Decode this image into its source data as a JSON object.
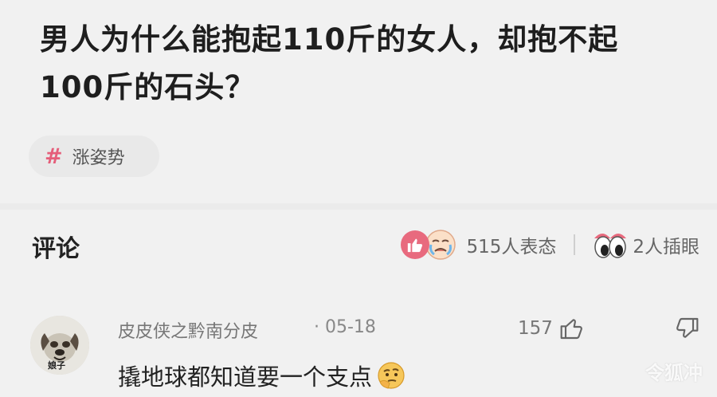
{
  "question": {
    "line1": "男人为什么能抱起110斤的女人，却抱不起",
    "line2": "100斤的石头？"
  },
  "tag": {
    "symbol": "#",
    "label": "涨姿势"
  },
  "comments": {
    "title": "评论",
    "reactions_text": "515人表态",
    "eyes_text": "2人插眼"
  },
  "comment": {
    "author": "皮皮侠之黔南分皮",
    "date": "· 05-18",
    "likes": "157",
    "text": "撬地球都知道要一个支点",
    "avatar_caption": "娘子"
  },
  "watermark": "令狐冲",
  "colors": {
    "background": "#f1f1f1",
    "tag_hash": "#e55e7a",
    "like_badge": "#e86a7e"
  }
}
